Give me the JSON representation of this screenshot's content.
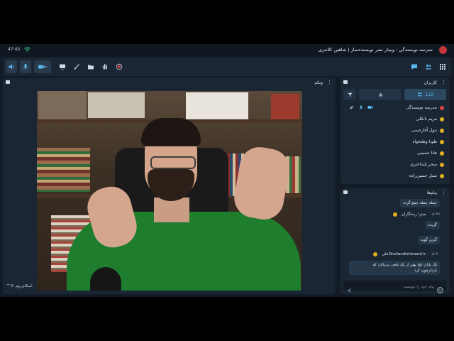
{
  "titlebar": {
    "time": "47:45",
    "title": "مدرسه نویسندگی : وبینار نشر نویسنده‌ساز | شاهین کلانتری"
  },
  "colors": {
    "accent": "#58b8f0",
    "bg": "#121b26",
    "panel": "#1a2633",
    "live": "#26d07c",
    "brand": "#c7353b"
  },
  "toolbar": {
    "left_icons": [
      "speaker-icon",
      "mic-icon",
      "camera-icon",
      "screen-share-icon",
      "brush-icon",
      "folder-icon",
      "hand-icon",
      "record-icon"
    ],
    "right_icons": [
      "chat-icon",
      "users-icon",
      "grid-icon"
    ]
  },
  "webcam": {
    "title": "وبکم",
    "watermark": "اسکای‌روم ©™"
  },
  "users": {
    "title": "کاربران",
    "count": "122",
    "list": [
      {
        "name": "مدرسه نویسندگی",
        "role": "host"
      },
      {
        "name": "مریم نانکلی",
        "role": "user"
      },
      {
        "name": "بتول آقارحیمی",
        "role": "user"
      },
      {
        "name": "طوبا وطنخواه",
        "role": "user"
      },
      {
        "name": "هانا حسینی",
        "role": "user"
      },
      {
        "name": "سحر بلنداختری",
        "role": "user"
      },
      {
        "name": "نسل حسین‌زاده",
        "role": "user"
      }
    ]
  },
  "messages": {
    "title": "پیام‌ها",
    "items": [
      {
        "type": "text",
        "text": "جمله جمله جمع گردد"
      },
      {
        "type": "sender",
        "name": "میترا رستگاران",
        "time": "۰۵:۲۹"
      },
      {
        "type": "text",
        "text": "گزیده"
      },
      {
        "type": "text",
        "text": "گزین گویه"
      },
      {
        "type": "sender",
        "name": "Draliandishmand.irعلی",
        "time": "۰۵:۳۰"
      },
      {
        "type": "text",
        "text": "یک پایان تلخ بهتر از یک تلخی بی‌پایان که"
      },
      {
        "type": "text",
        "text": "باردارمون کرد"
      }
    ],
    "placeholder": "پیام خود را بنویسید"
  }
}
